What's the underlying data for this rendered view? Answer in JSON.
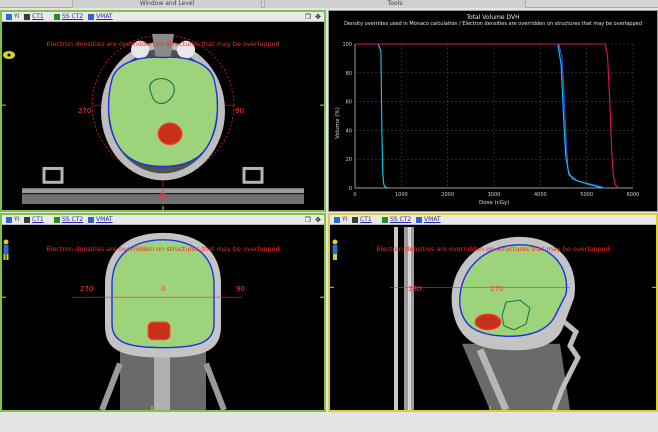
{
  "top_tabs": [
    "Window and Level",
    "Tools"
  ],
  "toolbar": {
    "pos_label": "Yi",
    "ct_label": "CT1",
    "series_label": "SS CT2",
    "dose_label": "VMAT",
    "window_controls": "❐ ✥"
  },
  "views": {
    "axial": {
      "warning": "Electron densities are overridden on structures that may be overlapped",
      "angle_left": "270",
      "angle_right": "90"
    },
    "coronal": {
      "warning": "Electron densities are overridden on structures that may be overlapped",
      "angle_left": "270",
      "angle_center": "0",
      "angle_right": "90"
    },
    "sagittal": {
      "warning": "Electron densities are overridden on structures that may be overlapped",
      "angle_left": "180",
      "angle_center": "270"
    }
  },
  "dvh": {
    "title": "Total Volume DVH",
    "subtitle": "Density overrides used in Monaco calculation / Electron densities are overridden on structures that may be overlapped",
    "colors": {
      "brain": "#2a4dff",
      "brain2": "#18c8f0",
      "ptv": "#e0106a",
      "grid": "#6b6b6b",
      "axis": "#cfcfcf"
    }
  },
  "chart_data": {
    "type": "line",
    "title": "Total Volume DVH",
    "subtitle": "Density overrides used in Monaco calculation / Electron densities are overridden on structures that may be overlapped",
    "xlabel": "Dose (cGy)",
    "ylabel": "Volume (%)",
    "xlim": [
      0,
      6000
    ],
    "ylim": [
      0,
      100
    ],
    "x_ticks": [
      0,
      1000,
      2000,
      3000,
      4000,
      5000,
      6000
    ],
    "y_ticks": [
      0,
      20,
      40,
      60,
      80,
      100
    ],
    "grid": true,
    "series": [
      {
        "color": "#18c8f0",
        "x": [
          0,
          500,
          560,
          580,
          600,
          620,
          640,
          700
        ],
        "y": [
          100,
          100,
          95,
          40,
          10,
          3,
          1,
          0
        ]
      },
      {
        "color": "#2a4dff",
        "x": [
          0,
          4400,
          4470,
          4520,
          4560,
          4600,
          4700,
          4900,
          5200,
          5400
        ],
        "y": [
          100,
          100,
          90,
          60,
          30,
          12,
          6,
          4,
          2,
          0
        ]
      },
      {
        "color": "#18c8f0",
        "x": [
          0,
          4380,
          4450,
          4500,
          4550,
          4620,
          4800,
          5100,
          5350
        ],
        "y": [
          100,
          100,
          85,
          50,
          22,
          9,
          5,
          2,
          0
        ]
      },
      {
        "color": "#e0106a",
        "x": [
          0,
          5400,
          5450,
          5500,
          5540,
          5580,
          5620,
          5700
        ],
        "y": [
          100,
          100,
          92,
          60,
          25,
          8,
          2,
          0
        ]
      }
    ]
  }
}
